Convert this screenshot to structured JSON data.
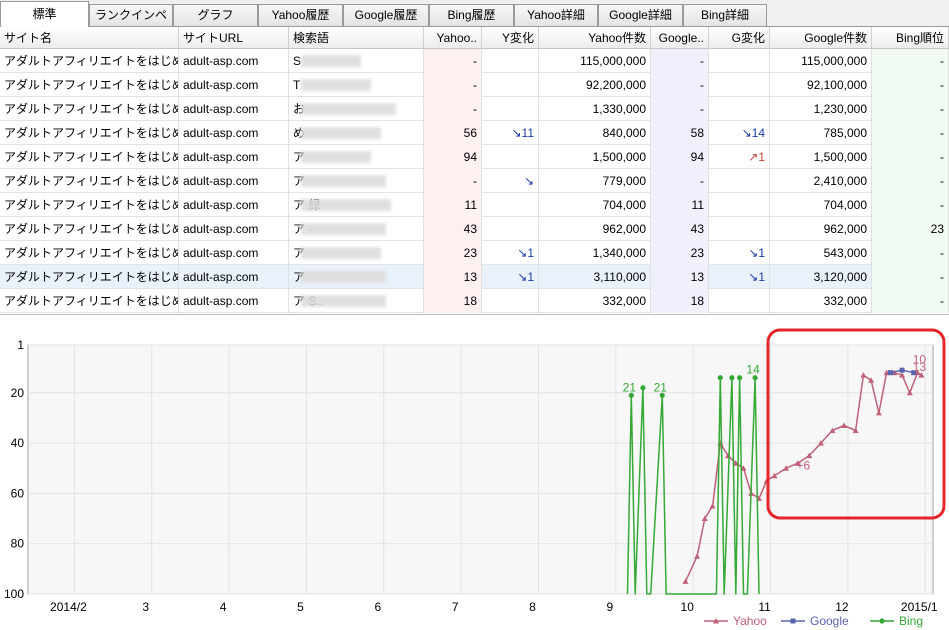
{
  "tabs": [
    {
      "label": "標準",
      "active": true
    },
    {
      "label": "ランクインページ"
    },
    {
      "label": "グラフ"
    },
    {
      "label": "Yahoo履歴"
    },
    {
      "label": "Google履歴"
    },
    {
      "label": "Bing履歴"
    },
    {
      "label": "Yahoo詳細"
    },
    {
      "label": "Google詳細"
    },
    {
      "label": "Bing詳細"
    }
  ],
  "table": {
    "columns": [
      "サイト名",
      "サイトURL",
      "検索語",
      "Yahoo..",
      "Y変化",
      "Yahoo件数",
      "Google..",
      "G変化",
      "Google件数",
      "Bing順位"
    ],
    "rows": [
      {
        "site": "アダルトアフィリエイトをはじめよう！",
        "url": "adult-asp.com",
        "kw": "S",
        "yahoo": "-",
        "ychg": "",
        "ycount": "115,000,000",
        "google": "-",
        "gchg": "",
        "gcount": "115,000,000",
        "bing": "-"
      },
      {
        "site": "アダルトアフィリエイトをはじめよう！",
        "url": "adult-asp.com",
        "kw": "T",
        "yahoo": "-",
        "ychg": "",
        "ycount": "92,200,000",
        "google": "-",
        "gchg": "",
        "gcount": "92,100,000",
        "bing": "-"
      },
      {
        "site": "アダルトアフィリエイトをはじめよう！",
        "url": "adult-asp.com",
        "kw": "お",
        "yahoo": "-",
        "ychg": "",
        "ycount": "1,330,000",
        "google": "-",
        "gchg": "",
        "gcount": "1,230,000",
        "bing": "-"
      },
      {
        "site": "アダルトアフィリエイトをはじめよう！",
        "url": "adult-asp.com",
        "kw": "め",
        "yahoo": "56",
        "ychg": "↘11",
        "ycount": "840,000",
        "google": "58",
        "gchg": "↘14",
        "gcount": "785,000",
        "bing": "-"
      },
      {
        "site": "アダルトアフィリエイトをはじめよう！",
        "url": "adult-asp.com",
        "kw": "ア",
        "yahoo": "94",
        "ychg": "",
        "ycount": "1,500,000",
        "google": "94",
        "gchg": "↗1",
        "gcount": "1,500,000",
        "bing": "-"
      },
      {
        "site": "アダルトアフィリエイトをはじめよう！",
        "url": "adult-asp.com",
        "kw": "ア",
        "yahoo": "-",
        "ychg": "↘",
        "ycount": "779,000",
        "google": "-",
        "gchg": "",
        "gcount": "2,410,000",
        "bing": "-"
      },
      {
        "site": "アダルトアフィリエイトをはじめよう！",
        "url": "adult-asp.com",
        "kw": "ア                                   緑",
        "yahoo": "11",
        "ychg": "",
        "ycount": "704,000",
        "google": "11",
        "gchg": "",
        "gcount": "704,000",
        "bing": "-"
      },
      {
        "site": "アダルトアフィリエイトをはじめよう！",
        "url": "adult-asp.com",
        "kw": "ア                                -",
        "yahoo": "43",
        "ychg": "",
        "ycount": "962,000",
        "google": "43",
        "gchg": "",
        "gcount": "962,000",
        "bing": "23"
      },
      {
        "site": "アダルトアフィリエイトをはじめよう！",
        "url": "adult-asp.com",
        "kw": "ア",
        "yahoo": "23",
        "ychg": "↘1",
        "ycount": "1,340,000",
        "google": "23",
        "gchg": "↘1",
        "gcount": "543,000",
        "bing": "-"
      },
      {
        "site": "アダルトアフィリエイトをはじめよう！",
        "url": "adult-asp.com",
        "kw": "ア",
        "yahoo": "13",
        "ychg": "↘1",
        "ycount": "3,110,000",
        "google": "13",
        "gchg": "↘1",
        "gcount": "3,120,000",
        "bing": "-"
      },
      {
        "site": "アダルトアフィリエイトをはじめよう！",
        "url": "adult-asp.com",
        "kw": "ア                                     S..",
        "yahoo": "18",
        "ychg": "",
        "ycount": "332,000",
        "google": "18",
        "gchg": "",
        "gcount": "332,000",
        "bing": "-"
      }
    ]
  },
  "chart_data": {
    "type": "line",
    "ylim": [
      100,
      1
    ],
    "y_inverted": true,
    "y_ticks": [
      "1",
      "20",
      "40",
      "60",
      "80",
      "100"
    ],
    "x_ticks": [
      "2014/2",
      "3",
      "4",
      "5",
      "6",
      "7",
      "8",
      "9",
      "10",
      "11",
      "12",
      "2015/1"
    ],
    "legend": [
      {
        "name": "Yahoo",
        "color": "#c06078"
      },
      {
        "name": "Google",
        "color": "#5a63b0"
      },
      {
        "name": "Bing",
        "color": "#35a835"
      }
    ],
    "legend_position": "bottom-right",
    "highlight_box_color": "#e3252d",
    "series": [
      {
        "name": "Yahoo",
        "color": "#c06078",
        "x": [
          9.9,
          10.05,
          10.15,
          10.25,
          10.35,
          10.45,
          10.55,
          10.65,
          10.75,
          10.85,
          10.95,
          11.05,
          11.2,
          11.35,
          11.5,
          11.65,
          11.8,
          11.95,
          12.1,
          12.2,
          12.3,
          12.4,
          12.5,
          12.6,
          12.7,
          12.8,
          12.9,
          12.95
        ],
        "y": [
          95,
          85,
          70,
          65,
          40,
          45,
          48,
          50,
          60,
          62,
          55,
          53,
          50,
          48,
          45,
          40,
          35,
          33,
          35,
          13,
          15,
          28,
          12,
          12,
          13,
          20,
          12,
          13
        ]
      },
      {
        "name": "Google",
        "color": "#5a63b0",
        "x": [
          12.55,
          12.7,
          12.85
        ],
        "y": [
          12,
          11,
          12
        ]
      },
      {
        "name": "Bing",
        "color": "#35a835",
        "x": [
          9.15,
          9.2,
          9.25,
          9.35,
          9.4,
          9.45,
          9.6,
          9.65,
          9.7,
          10.3,
          10.35,
          10.4,
          10.5,
          10.55,
          10.6,
          10.65,
          10.7,
          10.8,
          10.85
        ],
        "y": [
          100,
          21,
          100,
          18,
          100,
          100,
          21,
          100,
          100,
          100,
          14,
          100,
          14,
          100,
          14,
          100,
          100,
          14,
          100
        ]
      }
    ],
    "annotations": [
      {
        "text": "21",
        "series": "Bing",
        "x": 9.2,
        "y": 21
      },
      {
        "text": "21",
        "series": "Bing",
        "x": 9.6,
        "y": 21
      },
      {
        "text": "14",
        "series": "Bing",
        "x": 10.8,
        "y": 14
      },
      {
        "text": "10",
        "series": "Yahoo",
        "x": 12.95,
        "y": 10
      },
      {
        "text": "13",
        "series": "Yahoo",
        "x": 12.95,
        "y": 13
      },
      {
        "text": "+6",
        "series": "Yahoo",
        "x": 11.45,
        "y": 52
      }
    ]
  }
}
